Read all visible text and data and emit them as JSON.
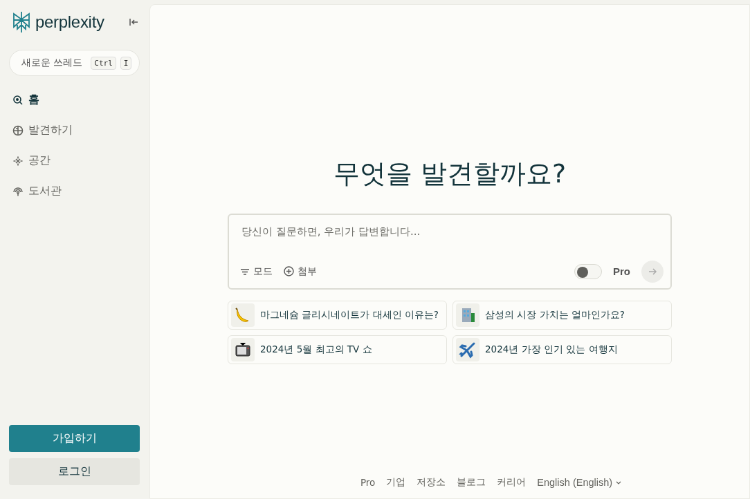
{
  "sidebar": {
    "logo": "perplexity",
    "new_thread": {
      "label": "새로운 쓰레드",
      "keys": [
        "Ctrl",
        "I"
      ]
    },
    "nav": [
      {
        "label": "홈",
        "selected": true
      },
      {
        "label": "발견하기",
        "selected": false
      },
      {
        "label": "공간",
        "selected": false
      },
      {
        "label": "도서관",
        "selected": false
      }
    ],
    "signup": "가입하기",
    "login": "로그인"
  },
  "main": {
    "heading": "무엇을 발견할까요?",
    "search": {
      "placeholder": "당신이 질문하면, 우리가 답변합니다...",
      "mode": "모드",
      "attach": "첨부",
      "pro": {
        "label": "Pro",
        "on": false
      }
    },
    "suggestions": [
      {
        "text": "마그네슘 글리시네이트가 대세인 이유는?"
      },
      {
        "text": "삼성의 시장 가치는 얼마인가요?"
      },
      {
        "text": "2024년 5월 최고의 TV 쇼"
      },
      {
        "text": "2024년 가장 인기 있는 여행지"
      }
    ],
    "footer": {
      "links": [
        "Pro",
        "기업",
        "저장소",
        "블로그",
        "커리어"
      ],
      "language": "English (English)"
    }
  }
}
